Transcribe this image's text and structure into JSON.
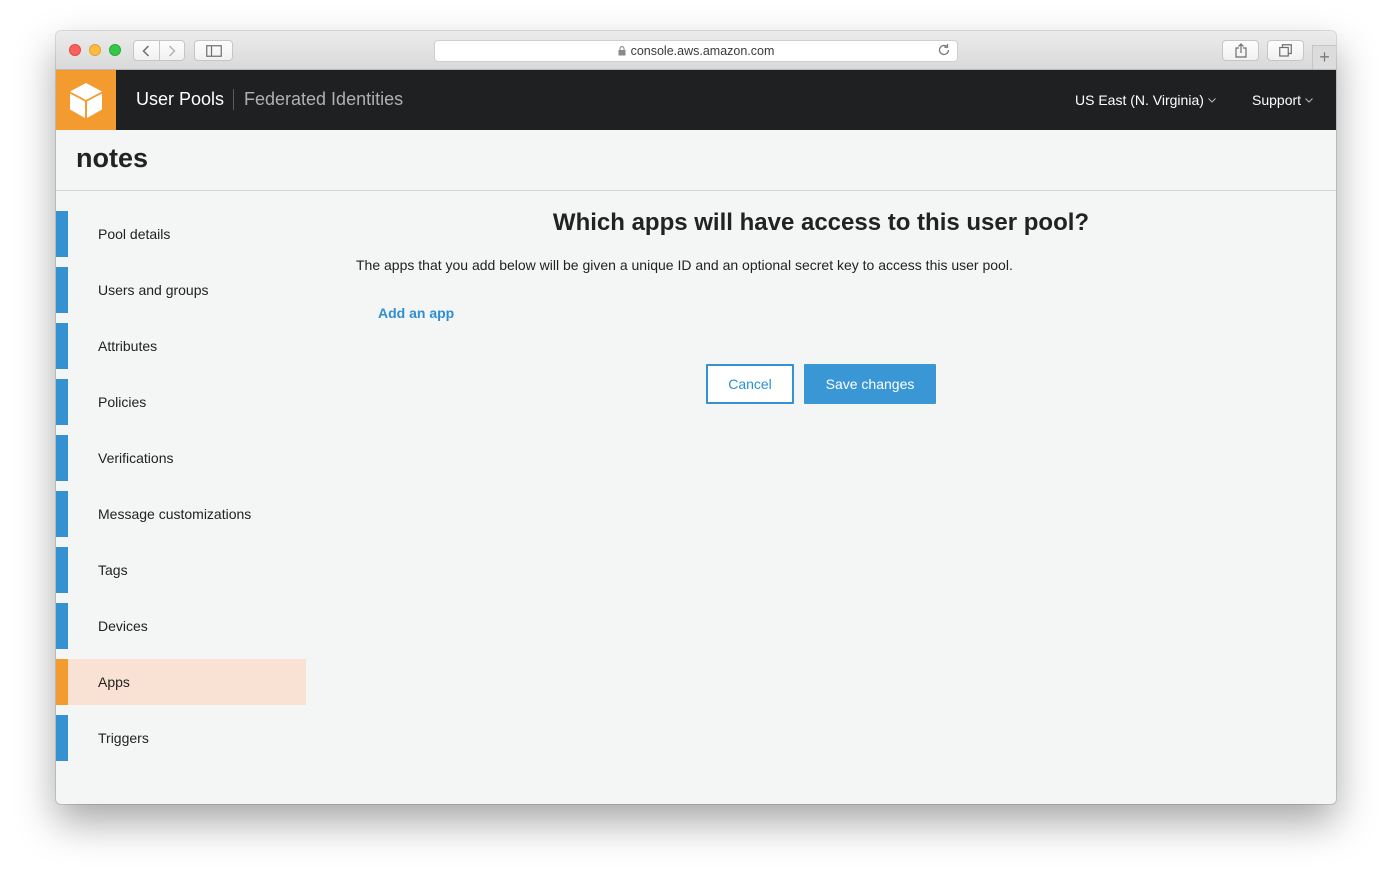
{
  "browser": {
    "url": "console.aws.amazon.com"
  },
  "header": {
    "active_link": "User Pools",
    "other_link": "Federated Identities",
    "region": "US East (N. Virginia)",
    "support": "Support"
  },
  "page": {
    "pool_name": "notes"
  },
  "sidebar": {
    "items": [
      {
        "label": "Pool details"
      },
      {
        "label": "Users and groups"
      },
      {
        "label": "Attributes"
      },
      {
        "label": "Policies"
      },
      {
        "label": "Verifications"
      },
      {
        "label": "Message customizations"
      },
      {
        "label": "Tags"
      },
      {
        "label": "Devices"
      },
      {
        "label": "Apps"
      },
      {
        "label": "Triggers"
      }
    ],
    "active_index": 8
  },
  "main": {
    "heading": "Which apps will have access to this user pool?",
    "description": "The apps that you add below will be given a unique ID and an optional secret key to access this user pool.",
    "add_link": "Add an app",
    "cancel_label": "Cancel",
    "save_label": "Save changes"
  },
  "colors": {
    "accent": "#3592d2",
    "brand_orange": "#f39b2f",
    "header_bg": "#1f2021",
    "active_item_bg": "#f9e1d3"
  }
}
